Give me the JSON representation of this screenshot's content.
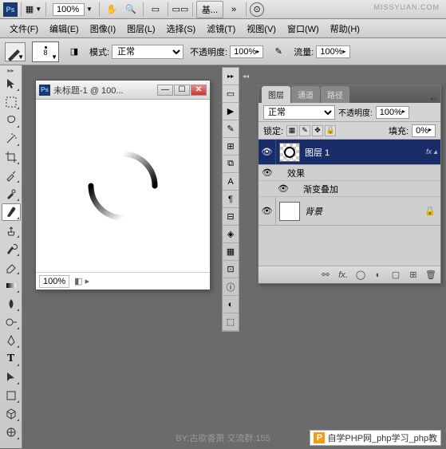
{
  "topbar": {
    "zoom": "100%",
    "btn_label": "基...",
    "watermark": "MISSYUAN.COM"
  },
  "menu": {
    "file": "文件(F)",
    "edit": "编辑(E)",
    "image": "图像(I)",
    "layer": "图层(L)",
    "select": "选择(S)",
    "filter": "滤镜(T)",
    "view": "视图(V)",
    "window": "窗口(W)",
    "help": "帮助(H)"
  },
  "options": {
    "brush_size": "8",
    "mode_label": "模式:",
    "mode_value": "正常",
    "opacity_label": "不透明度:",
    "opacity_value": "100%",
    "flow_label": "流量:",
    "flow_value": "100%"
  },
  "canvas_window": {
    "title": "未标题-1 @ 100...",
    "zoom": "100%"
  },
  "layers_panel": {
    "tabs": {
      "layers": "图层",
      "channels": "通道",
      "paths": "路径"
    },
    "blend_mode": "正常",
    "opacity_label": "不透明度:",
    "opacity_value": "100%",
    "lock_label": "锁定:",
    "fill_label": "填充:",
    "fill_value": "0%",
    "layer1_name": "图层 1",
    "effects_label": "效果",
    "gradient_overlay_label": "渐变叠加",
    "background_name": "背景"
  },
  "footer": {
    "credit": "BY:古欲香萧   交流群:155",
    "tag": "自学PHP网_php学习_php教"
  }
}
